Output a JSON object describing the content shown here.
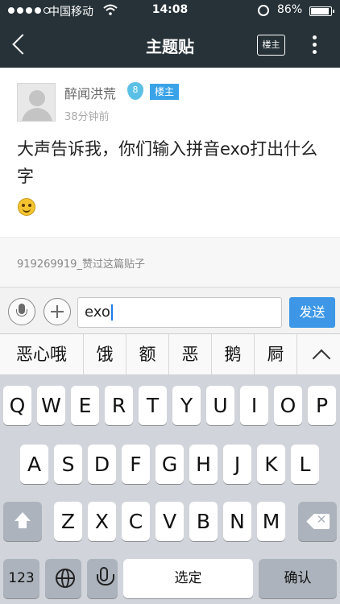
{
  "status_bar": {
    "carrier": "中国移动",
    "time": "14:08",
    "battery": "86%",
    "battery_level": 0.86
  },
  "nav": {
    "title": "主题贴",
    "owner_only_label": "楼主"
  },
  "post": {
    "username": "醉闻洪荒",
    "level": "8",
    "owner_tag": "楼主",
    "time": "38分钟前",
    "content": "大声告诉我，你们输入拼音exo打出什么字",
    "emoji": "smile-emoji"
  },
  "likes": {
    "text": "919269919_赞过这篇贴子"
  },
  "input": {
    "value": "exo",
    "send_label": "发送"
  },
  "candidates": [
    "恶心哦",
    "饿",
    "额",
    "恶",
    "鹅",
    "屙"
  ],
  "keyboard": {
    "row1": [
      "Q",
      "W",
      "E",
      "R",
      "T",
      "Y",
      "U",
      "I",
      "O",
      "P"
    ],
    "row2": [
      "A",
      "S",
      "D",
      "F",
      "G",
      "H",
      "J",
      "K",
      "L"
    ],
    "row3": [
      "Z",
      "X",
      "C",
      "V",
      "B",
      "N",
      "M"
    ],
    "numbers_label": "123",
    "space_label": "选定",
    "return_label": "确认"
  },
  "colors": {
    "nav_bg": "#263238",
    "accent": "#3d97e6",
    "level_badge": "#5bc0e6"
  }
}
